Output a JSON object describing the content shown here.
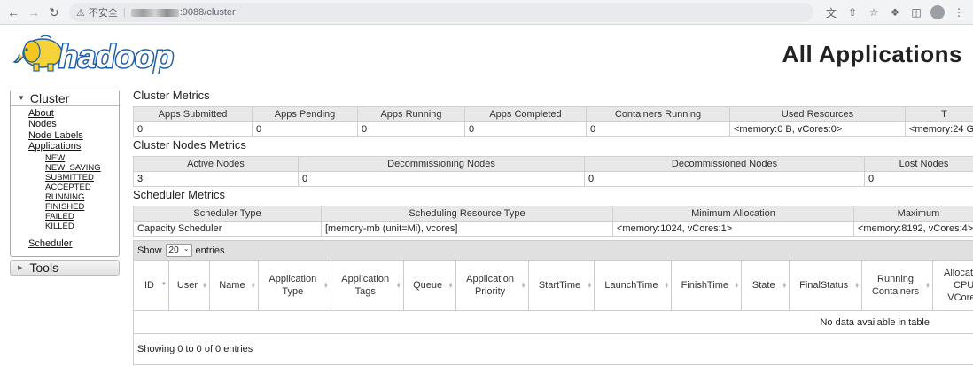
{
  "browser": {
    "insecure_label": "不安全",
    "url_suffix": ":9088/cluster"
  },
  "brand": {
    "logo_text": "hadoop",
    "brand_color": "#1e5fa8",
    "elephant_color": "#f7d33a"
  },
  "page_title": "All Applications",
  "sidebar": {
    "cluster_label": "Cluster",
    "links": [
      "About",
      "Nodes",
      "Node Labels",
      "Applications"
    ],
    "app_states": [
      "NEW",
      "NEW_SAVING",
      "SUBMITTED",
      "ACCEPTED",
      "RUNNING",
      "FINISHED",
      "FAILED",
      "KILLED"
    ],
    "scheduler_label": "Scheduler",
    "tools_label": "Tools"
  },
  "cluster_metrics": {
    "title": "Cluster Metrics",
    "headers": [
      "Apps Submitted",
      "Apps Pending",
      "Apps Running",
      "Apps Completed",
      "Containers Running",
      "Used Resources",
      "T"
    ],
    "values": [
      "0",
      "0",
      "0",
      "0",
      "0",
      "<memory:0 B, vCores:0>",
      "<memory:24 G"
    ]
  },
  "nodes_metrics": {
    "title": "Cluster Nodes Metrics",
    "headers": [
      "Active Nodes",
      "Decommissioning Nodes",
      "Decommissioned Nodes",
      "Lost Nodes"
    ],
    "values": [
      "3",
      "0",
      "0",
      "0"
    ]
  },
  "scheduler_metrics": {
    "title": "Scheduler Metrics",
    "headers": [
      "Scheduler Type",
      "Scheduling Resource Type",
      "Minimum Allocation",
      "Maximum"
    ],
    "values": [
      "Capacity Scheduler",
      "[memory-mb (unit=Mi), vcores]",
      "<memory:1024, vCores:1>",
      "<memory:8192, vCores:4>"
    ]
  },
  "apps_table": {
    "show_label": "Show",
    "page_length": "20",
    "entries_label": "entries",
    "columns": [
      "ID",
      "User",
      "Name",
      "Application Type",
      "Application Tags",
      "Queue",
      "Application Priority",
      "StartTime",
      "LaunchTime",
      "FinishTime",
      "State",
      "FinalStatus",
      "Running Containers",
      "Allocated CPU VCores"
    ],
    "empty_message": "No data available in table",
    "info": "Showing 0 to 0 of 0 entries"
  }
}
